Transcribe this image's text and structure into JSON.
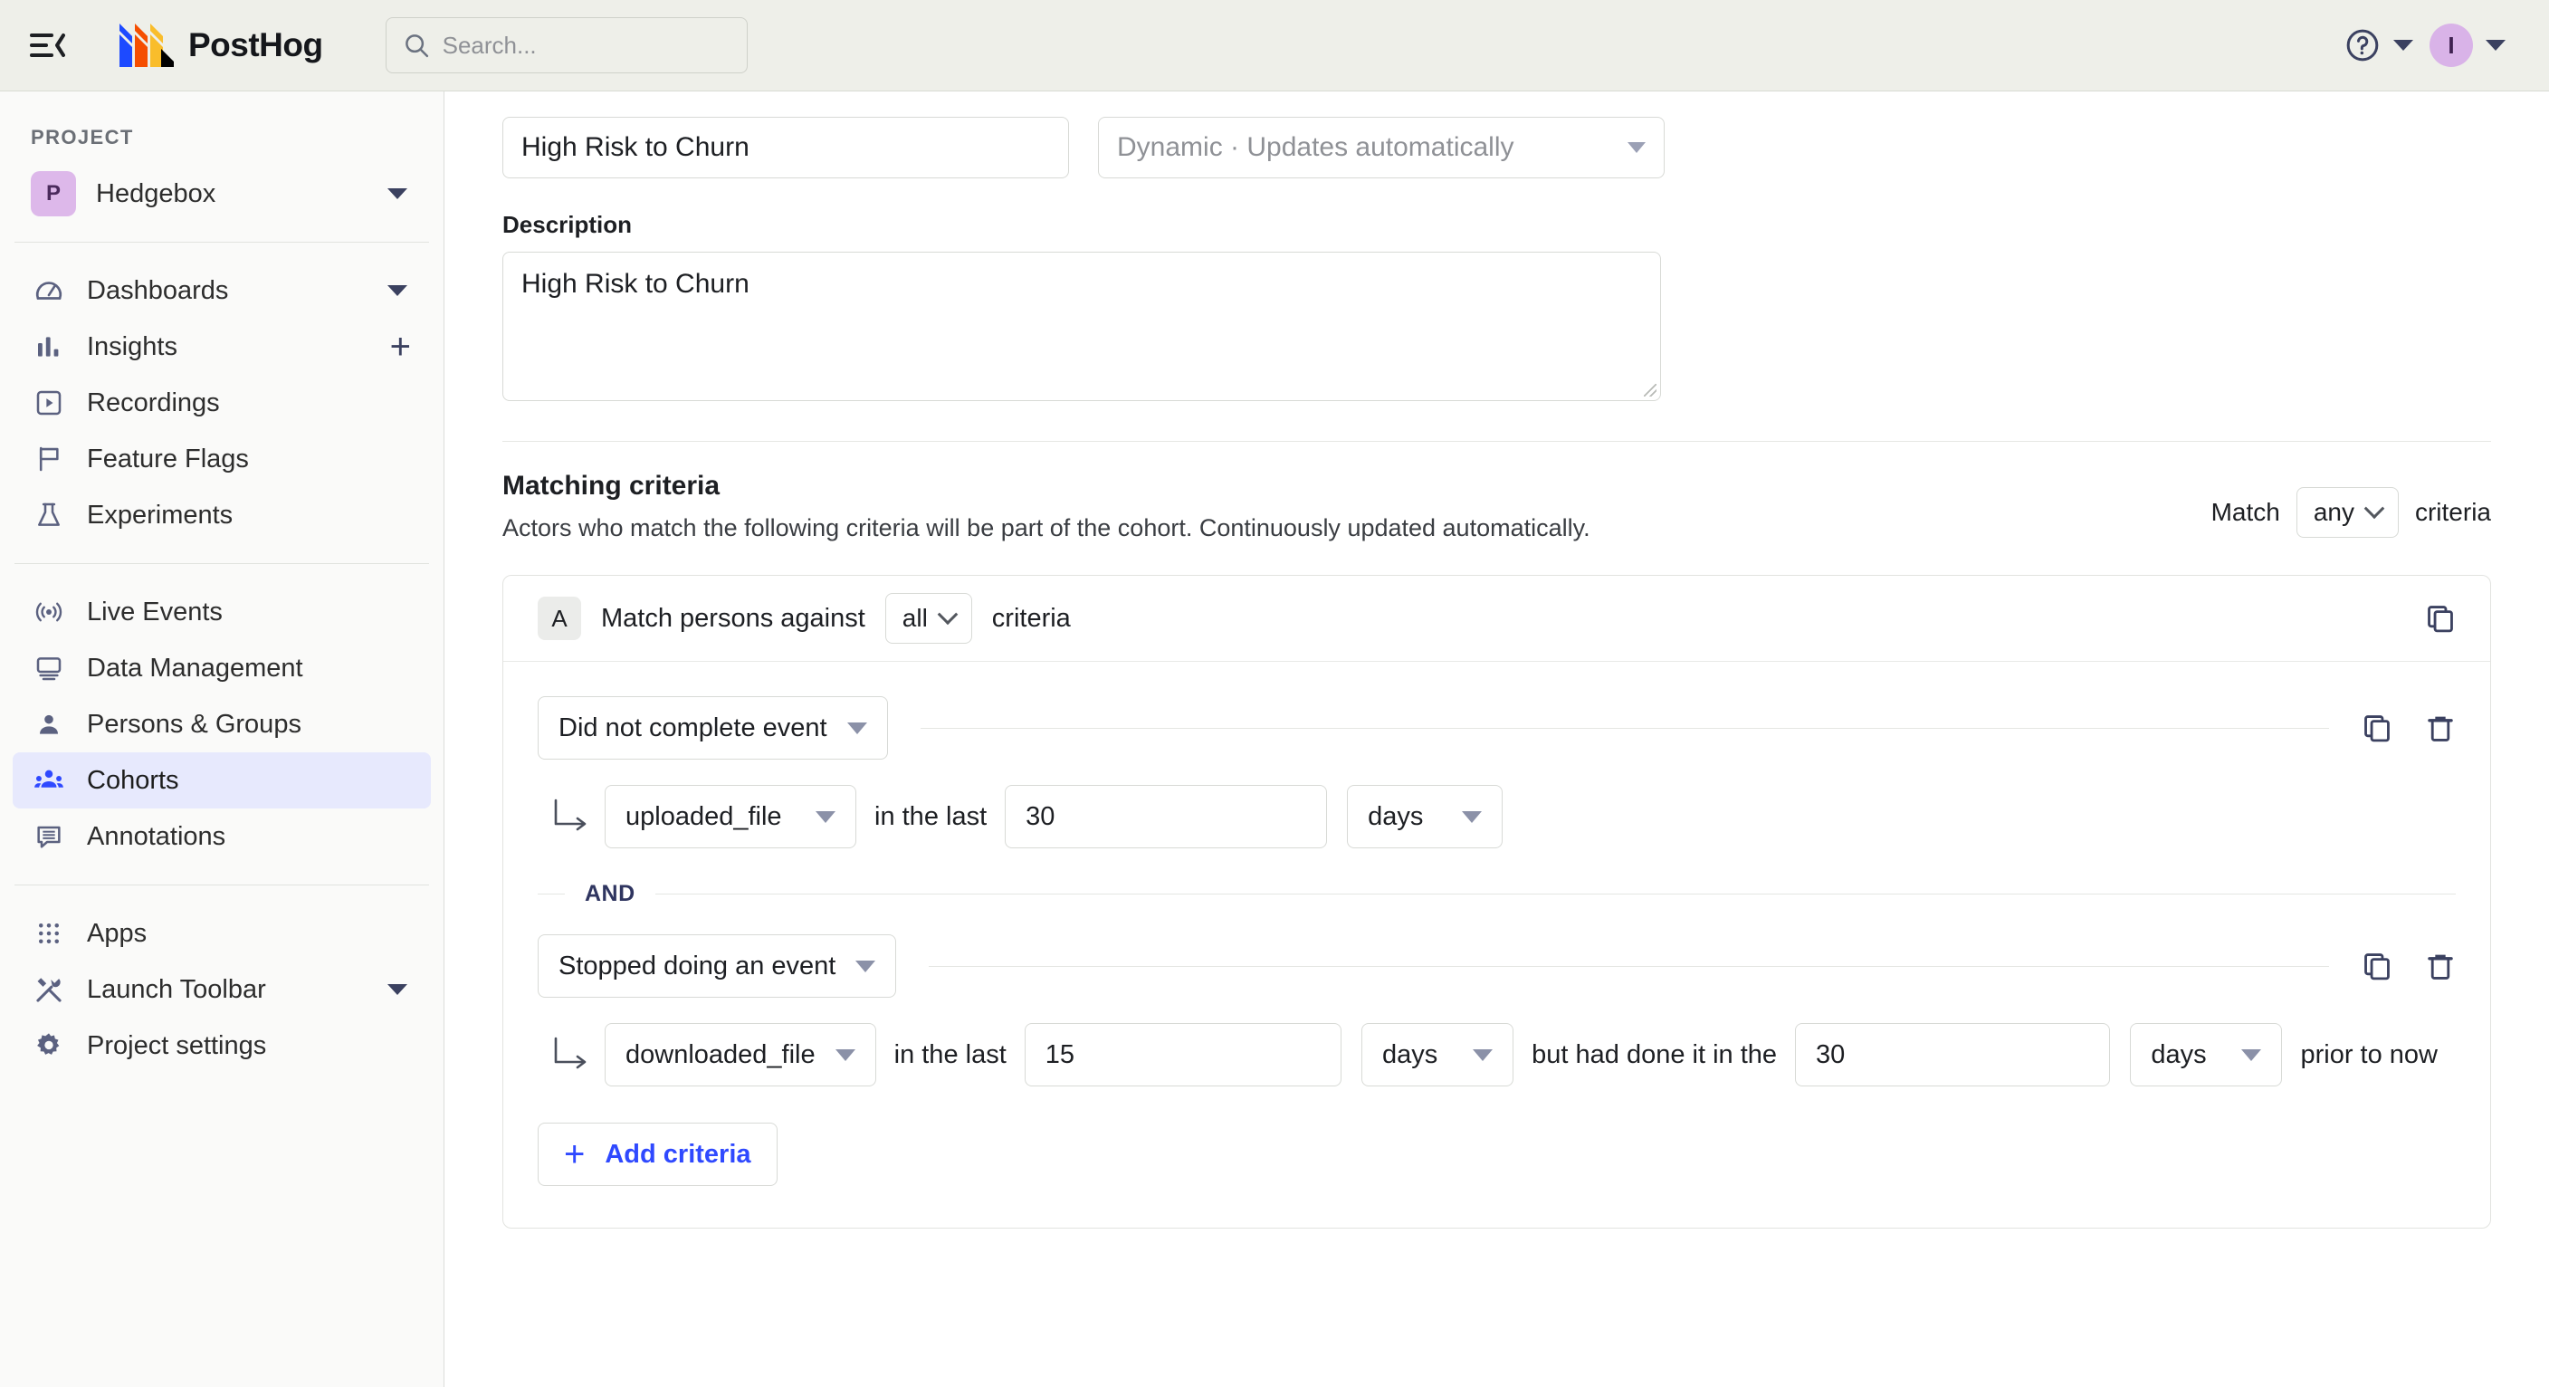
{
  "topbar": {
    "menu_icon": "hamburger-collapse-icon",
    "brand_name": "PostHog",
    "brand_logo_icon": "posthog-logo-icon",
    "search": {
      "icon": "search-icon",
      "placeholder": "Search...",
      "value": ""
    },
    "help_icon": "help-circle-icon",
    "help_caret_icon": "caret-down-icon",
    "avatar_initial": "I",
    "avatar_caret_icon": "caret-down-icon",
    "bg_color": "#EEEFE9"
  },
  "sidebar": {
    "section_label": "PROJECT",
    "project": {
      "badge": "P",
      "name": "Hedgebox",
      "caret_icon": "caret-down-icon",
      "badge_color": "#DDB8EA"
    },
    "groups": [
      {
        "items": [
          {
            "label": "Dashboards",
            "icon": "gauge-icon",
            "trailing": "caret-down-icon",
            "active": false
          },
          {
            "label": "Insights",
            "icon": "bar-chart-icon",
            "trailing": "plus-icon",
            "active": false
          },
          {
            "label": "Recordings",
            "icon": "play-square-icon",
            "trailing": "",
            "active": false
          },
          {
            "label": "Feature Flags",
            "icon": "flag-icon",
            "trailing": "",
            "active": false
          },
          {
            "label": "Experiments",
            "icon": "flask-icon",
            "trailing": "",
            "active": false
          }
        ]
      },
      {
        "items": [
          {
            "label": "Live Events",
            "icon": "live-broadcast-icon",
            "trailing": "",
            "active": false
          },
          {
            "label": "Data Management",
            "icon": "monitor-icon",
            "trailing": "",
            "active": false
          },
          {
            "label": "Persons & Groups",
            "icon": "person-icon",
            "trailing": "",
            "active": false
          },
          {
            "label": "Cohorts",
            "icon": "people-group-icon",
            "trailing": "",
            "active": true
          },
          {
            "label": "Annotations",
            "icon": "comment-lines-icon",
            "trailing": "",
            "active": false
          }
        ]
      },
      {
        "items": [
          {
            "label": "Apps",
            "icon": "grid-dots-icon",
            "trailing": "",
            "active": false
          },
          {
            "label": "Launch Toolbar",
            "icon": "tools-icon",
            "trailing": "caret-down-icon",
            "active": false
          },
          {
            "label": "Project settings",
            "icon": "gear-icon",
            "trailing": "",
            "active": false
          }
        ]
      }
    ],
    "active_bg": "#E7E9FD",
    "active_icon_color": "#2F49FF"
  },
  "main": {
    "name_field": {
      "value": "High Risk to Churn",
      "placeholder": "Name"
    },
    "type_select": {
      "value": "Dynamic · Updates automatically",
      "caret_icon": "caret-down-icon"
    },
    "description_label": "Description",
    "description_field": {
      "value": "High Risk to Churn",
      "placeholder": "Description"
    },
    "matching": {
      "title": "Matching criteria",
      "subtitle": "Actors who match the following criteria will be part of the cohort. Continuously updated automatically.",
      "match_prefix": "Match",
      "match_value": "any",
      "match_suffix": "criteria",
      "match_caret_icon": "chevron-down-icon"
    },
    "card": {
      "badge_letter": "A",
      "header_text_prefix": "Match persons against",
      "header_select_value": "all",
      "header_select_caret_icon": "chevron-down-icon",
      "header_text_suffix": "criteria",
      "header_duplicate_icon": "duplicate-icon",
      "rows": [
        {
          "type_value": "Did not complete event",
          "type_caret_icon": "caret-down-icon",
          "duplicate_icon": "duplicate-icon",
          "delete_icon": "trash-icon",
          "elbow_icon": "elbow-arrow-icon",
          "event_value": "uploaded_file",
          "event_caret_icon": "caret-down-icon",
          "mid_text": "in the last",
          "time_value": "30",
          "unit_value": "days",
          "unit_caret_icon": "caret-down-icon",
          "tail_text": "",
          "second_time_value": "",
          "second_unit_value": "",
          "end_text": ""
        },
        {
          "type_value": "Stopped doing an event",
          "type_caret_icon": "caret-down-icon",
          "duplicate_icon": "duplicate-icon",
          "delete_icon": "trash-icon",
          "elbow_icon": "elbow-arrow-icon",
          "event_value": "downloaded_file",
          "event_caret_icon": "caret-down-icon",
          "mid_text": "in the last",
          "time_value": "15",
          "unit_value": "days",
          "unit_caret_icon": "caret-down-icon",
          "tail_text": "but had done it in the",
          "second_time_value": "30",
          "second_unit_value": "days",
          "end_text": "prior to now"
        }
      ],
      "and_label": "AND",
      "add_criteria_label": "Add criteria",
      "add_criteria_icon": "plus-icon"
    }
  },
  "colors": {
    "accent_blue": "#2F49FF",
    "icon_navy": "#3B4160",
    "topbar_bg": "#EEEFE9",
    "sidebar_bg": "#FAFAF9"
  }
}
